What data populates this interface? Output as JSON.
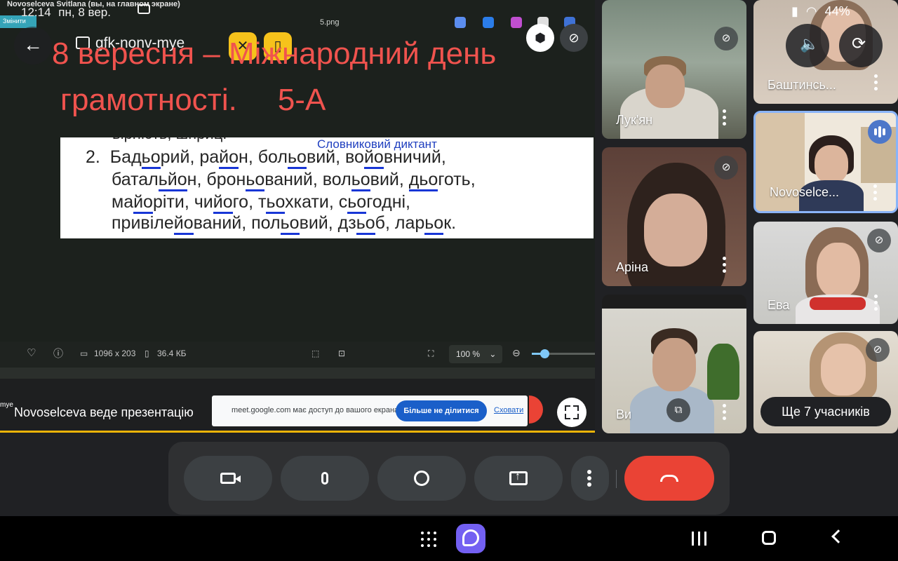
{
  "presenter_window": {
    "sharer_status": "Novoselceva Svitlana (вы, на главном экране)",
    "change_button": "Змінити",
    "file_title": "5.png"
  },
  "device_status": {
    "time": "12:14",
    "date": "пн, 8 вер.",
    "battery": "44%"
  },
  "meeting": {
    "back_icon": "arrow-left-icon",
    "code": "gfk-nonv-mye"
  },
  "slide_overlay": {
    "line1": "8 вересня – Міжнародний день",
    "line2": "грамотності.",
    "class_label": "5-А"
  },
  "slide": {
    "cut_top": "вірність, шприц.",
    "caption": "Словниковий диктант",
    "number": "2.",
    "rows": [
      [
        "Бад",
        "ьо",
        "рий, ра",
        "йо",
        "н, бол",
        "ьо",
        "вий, во",
        "йо",
        "вничий,"
      ],
      [
        "батал",
        "ьйо",
        "н, брон",
        "ьо",
        "ваний, вол",
        "ьо",
        "вий, ",
        "дьо",
        "готь,"
      ],
      [
        "ма",
        "йо",
        "ріти, чи",
        "йо",
        "го, т",
        "ьо",
        "хкати, с",
        "ьо",
        "годні,"
      ],
      [
        "привіле",
        "йо",
        "ваний,  пол",
        "ьо",
        "вий, дз",
        "ьо",
        "б, лар",
        "ьо",
        "к."
      ]
    ]
  },
  "image_viewer": {
    "dimensions": "1096 x 203",
    "file_size": "36.4 КБ",
    "zoom": "100 %",
    "zoom_slider_fraction": 0.2
  },
  "presentation": {
    "tag": "mye",
    "label": "Novoselceva веде презентацію",
    "share_notice": "meet.google.com має доступ до вашого екрана.",
    "stop_sharing": "Більше не ділитися",
    "hide": "Сховати"
  },
  "participants": [
    {
      "name": "Лук'ян",
      "mic": "muted"
    },
    {
      "name": "Аріна",
      "mic": "muted"
    },
    {
      "name": "Ви",
      "mic": "muted"
    },
    {
      "name": "Баштинсь...",
      "mic": "muted"
    },
    {
      "name": "Novoselce...",
      "mic": "speaking"
    },
    {
      "name": "Ева",
      "mic": "muted"
    },
    {
      "name": "",
      "mic": "muted"
    }
  ],
  "more_participants": "Ще 7 учасників",
  "controls": {
    "camera": "camera-icon",
    "mic": "microphone-icon",
    "reactions": "emoji-icon",
    "present": "present-screen-icon",
    "more": "more-vertical-icon",
    "end_call": "hang-up-icon"
  },
  "colors": {
    "title_red": "#f0534e",
    "end_call_red": "#ea4335",
    "stop_share_blue": "#1a5fc9",
    "underline_blue": "#1836d6",
    "speaking_blue": "#4d77c9"
  }
}
